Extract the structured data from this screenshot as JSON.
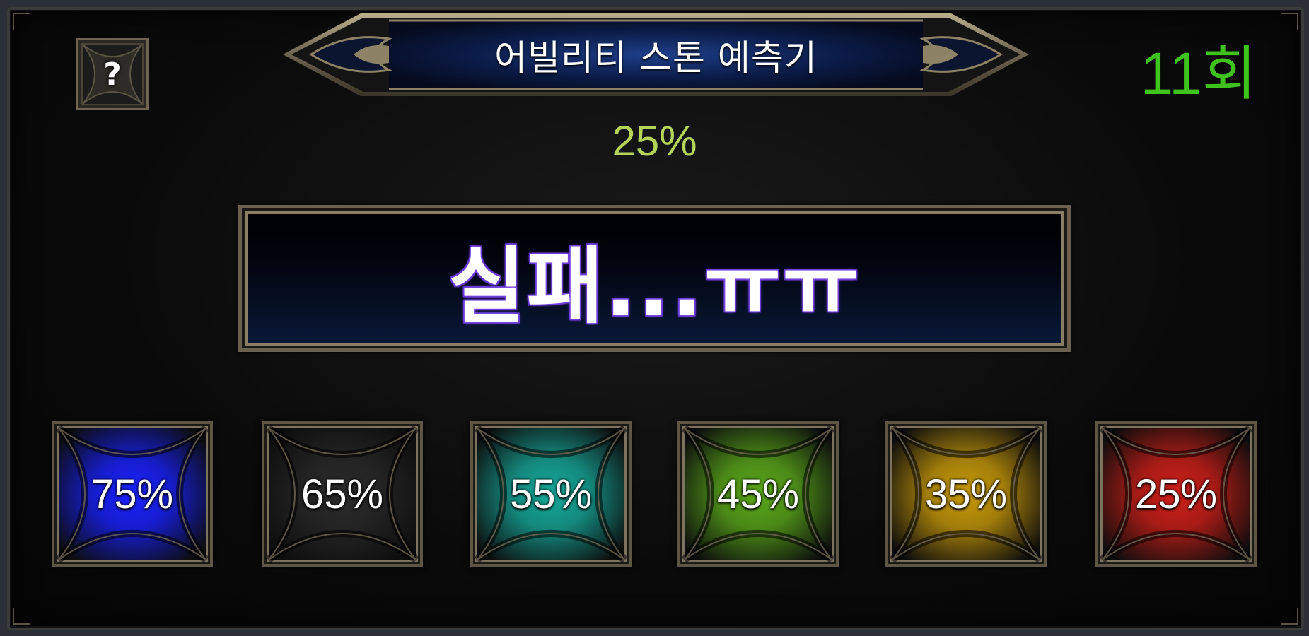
{
  "title": "어빌리티 스톤 예측기",
  "help": {
    "label": "?"
  },
  "attempt_count": "11회",
  "current_probability": "25%",
  "result": "실패...ㅠㅠ",
  "stones": [
    {
      "label": "75%",
      "color": "#1a22ff"
    },
    {
      "label": "65%",
      "color": "#2a2a2a"
    },
    {
      "label": "55%",
      "color": "#16a89a"
    },
    {
      "label": "45%",
      "color": "#5aa81a"
    },
    {
      "label": "35%",
      "color": "#c89a0a"
    },
    {
      "label": "25%",
      "color": "#d0201a"
    }
  ],
  "colors": {
    "attempt_count": "#3fc31c",
    "current_probability": "#b6d45a",
    "frame_gold": "#8a7f66"
  }
}
